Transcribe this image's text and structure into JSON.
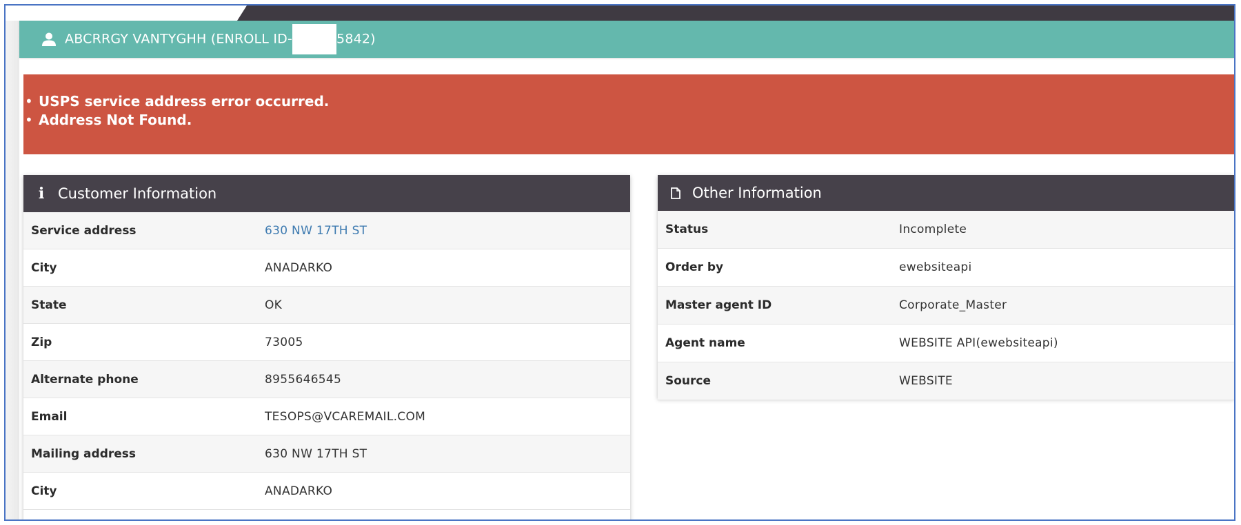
{
  "header": {
    "title_prefix": "ABCRRGY VANTYGHH (ENROLL ID-",
    "title_suffix": "5842)"
  },
  "alert": {
    "messages": [
      "USPS service address error occurred.",
      "Address Not Found."
    ],
    "color": "#cd5542"
  },
  "customer_info": {
    "heading": "Customer Information",
    "icon": "info-icon",
    "rows": [
      {
        "label": "Service address",
        "value": "630 NW 17TH ST"
      },
      {
        "label": "City",
        "value": "ANADARKO"
      },
      {
        "label": "State",
        "value": "OK"
      },
      {
        "label": "Zip",
        "value": "73005"
      },
      {
        "label": "Alternate phone",
        "value": "8955646545"
      },
      {
        "label": "Email",
        "value": "TESOPS@VCAREMAIL.COM"
      },
      {
        "label": "Mailing address",
        "value": "630 NW 17TH ST"
      },
      {
        "label": "City",
        "value": "ANADARKO"
      }
    ]
  },
  "other_info": {
    "heading": "Other Information",
    "icon": "document-icon",
    "rows": [
      {
        "label": "Status",
        "value": "Incomplete"
      },
      {
        "label": "Order by",
        "value": "ewebsiteapi"
      },
      {
        "label": "Master agent ID",
        "value": "Corporate_Master"
      },
      {
        "label": "Agent name",
        "value": "WEBSITE API(ewebsiteapi)"
      },
      {
        "label": "Source",
        "value": "WEBSITE"
      }
    ]
  },
  "colors": {
    "title_bar": "#64b8ad",
    "panel_header": "#46414a",
    "link": "#3d7ab0"
  }
}
